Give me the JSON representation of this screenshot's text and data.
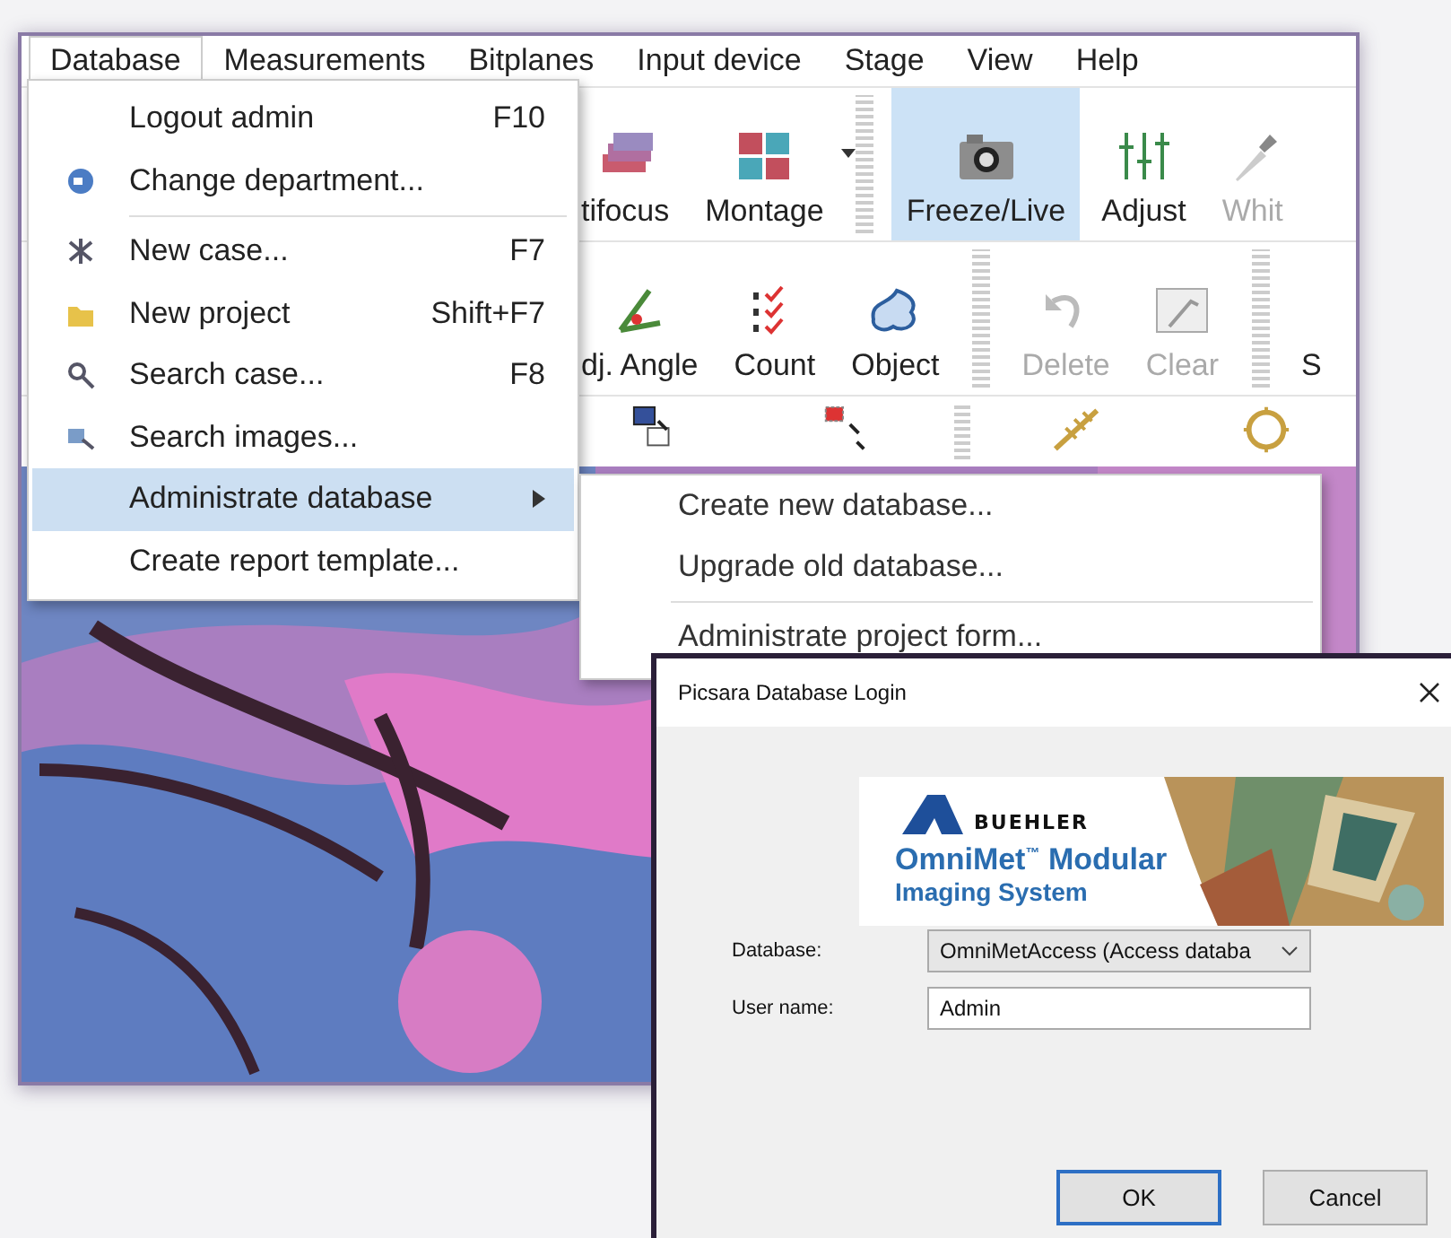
{
  "menu_bar": [
    {
      "label": "Database",
      "selected": true
    },
    {
      "label": "Measurements",
      "selected": false
    },
    {
      "label": "Bitplanes",
      "selected": false
    },
    {
      "label": "Input device",
      "selected": false
    },
    {
      "label": "Stage",
      "selected": false
    },
    {
      "label": "View",
      "selected": false
    },
    {
      "label": "Help",
      "selected": false
    }
  ],
  "toolbar_rows": [
    {
      "items": [
        {
          "kind": "multifocus",
          "label": "tifocus",
          "selected": false,
          "disabled": false
        },
        {
          "kind": "montage",
          "label": "Montage",
          "selected": false,
          "disabled": false,
          "dropdown": true
        },
        {
          "kind": "separator"
        },
        {
          "kind": "camera",
          "label": "Freeze/Live",
          "selected": true,
          "disabled": false
        },
        {
          "kind": "sliders",
          "label": "Adjust",
          "selected": false,
          "disabled": false
        },
        {
          "kind": "dropper",
          "label": "Whit",
          "selected": false,
          "disabled": true
        }
      ]
    },
    {
      "items": [
        {
          "kind": "angle",
          "label": "dj. Angle",
          "selected": false,
          "disabled": false
        },
        {
          "kind": "count",
          "label": "Count",
          "selected": false,
          "disabled": false
        },
        {
          "kind": "object",
          "label": "Object",
          "selected": false,
          "disabled": false
        },
        {
          "kind": "separator"
        },
        {
          "kind": "undo",
          "label": "Delete",
          "selected": false,
          "disabled": true
        },
        {
          "kind": "clear",
          "label": "Clear",
          "selected": false,
          "disabled": true
        },
        {
          "kind": "separator"
        },
        {
          "kind": "text",
          "label": "S",
          "selected": false,
          "disabled": false
        }
      ]
    },
    {
      "items": [
        {
          "kind": "copy"
        },
        {
          "kind": "select"
        },
        {
          "kind": "separator"
        },
        {
          "kind": "measure"
        },
        {
          "kind": "circle"
        }
      ]
    }
  ],
  "database_menu": [
    {
      "label": "Logout admin",
      "shortcut": "F10",
      "selected": false
    },
    {
      "label": "Change department...",
      "selected": false
    },
    {
      "label": "New case...",
      "shortcut": "F7",
      "separator_before": true,
      "selected": false
    },
    {
      "label": "New project",
      "shortcut": "Shift+F7",
      "selected": false
    },
    {
      "label": "Search case...",
      "shortcut": "F8",
      "selected": false
    },
    {
      "label": "Search images...",
      "selected": false
    },
    {
      "label": "Administrate database",
      "submenu": true,
      "selected": true
    },
    {
      "label": "Create report template...",
      "selected": false
    }
  ],
  "submenu": [
    {
      "label": "Create new database...",
      "separator_before": false
    },
    {
      "label": "Upgrade old database...",
      "separator_before": false
    },
    {
      "label": "Administrate project form...",
      "separator_before": true
    }
  ],
  "dialog": {
    "title": "Picsara Database Login",
    "banner": {
      "brand": "BUEHLER",
      "product": "OmniMet$^{™}$ Modular",
      "subtitle": "Imaging System"
    },
    "fields": [
      {
        "kind": "dropdown",
        "label": "Database:",
        "value": "OmniMetAccess (Access databa"
      },
      {
        "kind": "text",
        "label": "User name:",
        "value": "Admin"
      }
    ],
    "buttons": [
      {
        "label": "OK",
        "default": true
      },
      {
        "label": "Cancel",
        "default": false
      }
    ]
  }
}
